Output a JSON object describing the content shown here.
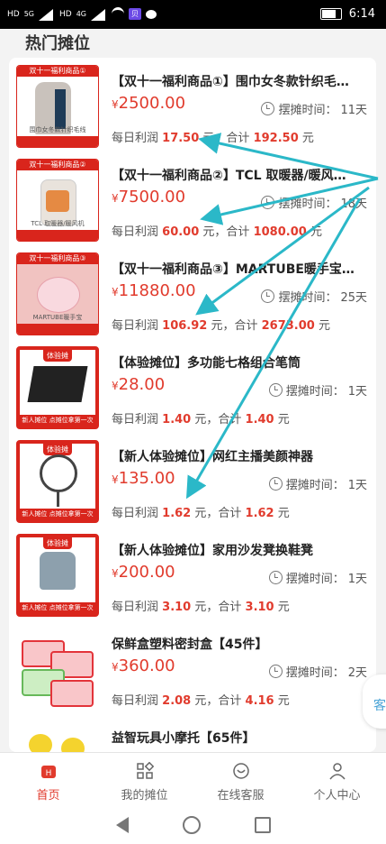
{
  "status_bar": {
    "left": [
      "HD",
      "5G",
      "HD",
      "4G"
    ],
    "chip": "贝",
    "time": "6:14"
  },
  "page_title": "热门摊位",
  "items": [
    {
      "name": "【双十一福利商品①】围巾女冬款针织毛…",
      "price_symbol": "¥",
      "price": "2500.00",
      "time_label": "摆摊时间：",
      "time_value": "11天",
      "profit_label": "每日利润",
      "profit_value": "17.50",
      "total_label": "元，合计",
      "total_value": "192.50",
      "unit": "元",
      "thumb_banner": "双十一福利商品①",
      "thumb_caption": "围巾女冬款针织毛线"
    },
    {
      "name": "【双十一福利商品②】TCL 取暖器/暖风…",
      "price_symbol": "¥",
      "price": "7500.00",
      "time_label": "摆摊时间：",
      "time_value": "18天",
      "profit_label": "每日利润",
      "profit_value": "60.00",
      "total_label": "元，合计",
      "total_value": "1080.00",
      "unit": "元",
      "thumb_banner": "双十一福利商品②",
      "thumb_caption": "TCL 取暖器/暖风机"
    },
    {
      "name": "【双十一福利商品③】MARTUBE暖手宝…",
      "price_symbol": "¥",
      "price": "11880.00",
      "time_label": "摆摊时间：",
      "time_value": "25天",
      "profit_label": "每日利润",
      "profit_value": "106.92",
      "total_label": "元，合计",
      "total_value": "2673.00",
      "unit": "元",
      "thumb_banner": "双十一福利商品③",
      "thumb_caption": "MARTUBE暖手宝"
    },
    {
      "name": "【体验摊位】多功能七格组合笔筒",
      "price_symbol": "¥",
      "price": "28.00",
      "time_label": "摆摊时间：",
      "time_value": "1天",
      "profit_label": "每日利润",
      "profit_value": "1.40",
      "total_label": "元，合计",
      "total_value": "1.40",
      "unit": "元",
      "thumb_badge": "体验摊",
      "thumb_footer": "新人摊位  点摊位拿第一次"
    },
    {
      "name": "【新人体验摊位】网红主播美颜神器",
      "price_symbol": "¥",
      "price": "135.00",
      "time_label": "摆摊时间：",
      "time_value": "1天",
      "profit_label": "每日利润",
      "profit_value": "1.62",
      "total_label": "元，合计",
      "total_value": "1.62",
      "unit": "元",
      "thumb_badge": "体验摊",
      "thumb_footer": "新人摊位  点摊位拿第一次"
    },
    {
      "name": "【新人体验摊位】家用沙发凳换鞋凳",
      "price_symbol": "¥",
      "price": "200.00",
      "time_label": "摆摊时间：",
      "time_value": "1天",
      "profit_label": "每日利润",
      "profit_value": "3.10",
      "total_label": "元，合计",
      "total_value": "3.10",
      "unit": "元",
      "thumb_badge": "体验摊",
      "thumb_footer": "新人摊位  点摊位拿第一次"
    },
    {
      "name": "保鲜盒塑料密封盒【45件】",
      "price_symbol": "¥",
      "price": "360.00",
      "time_label": "摆摊时间：",
      "time_value": "2天",
      "profit_label": "每日利润",
      "profit_value": "2.08",
      "total_label": "元，合计",
      "total_value": "4.16",
      "unit": "元"
    },
    {
      "name": "益智玩具小摩托【65件】",
      "price_symbol": "¥",
      "price": "",
      "time_label": "",
      "time_value": "",
      "profit_label": "",
      "profit_value": "",
      "total_label": "",
      "total_value": "",
      "unit": ""
    }
  ],
  "float_button": "客",
  "bottom_nav": [
    {
      "label": "首页",
      "icon": "home-icon",
      "active": true
    },
    {
      "label": "我的摊位",
      "icon": "grid-icon",
      "active": false
    },
    {
      "label": "在线客服",
      "icon": "chat-icon",
      "active": false
    },
    {
      "label": "个人中心",
      "icon": "user-icon",
      "active": false
    }
  ],
  "colors": {
    "accent": "#e13b2d",
    "arrow": "#2bb8c8"
  }
}
